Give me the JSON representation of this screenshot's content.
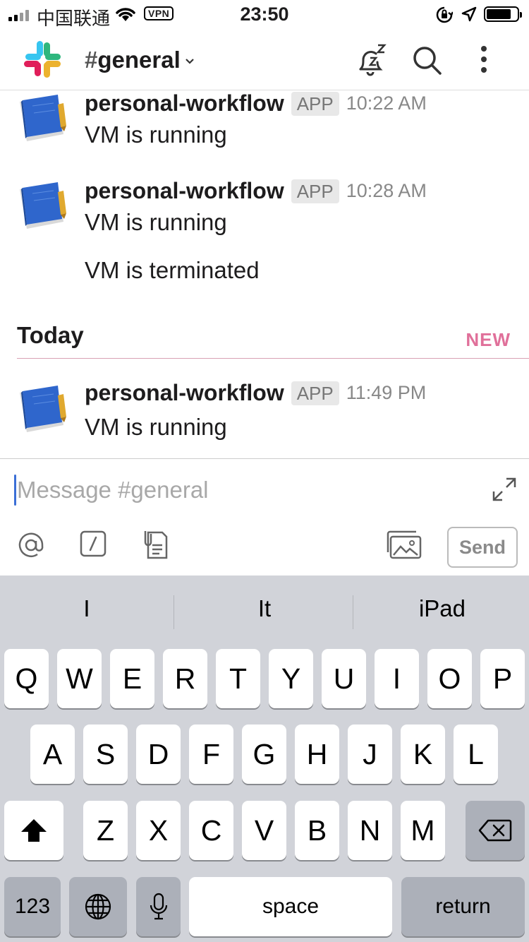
{
  "status_bar": {
    "carrier": "中国联通",
    "vpn": "VPN",
    "time": "23:50"
  },
  "header": {
    "hash": "#",
    "channel": "general",
    "icons": [
      "slack-logo-icon",
      "snooze-bell-icon",
      "search-icon",
      "more-vertical-icon"
    ]
  },
  "messages": [
    {
      "sender": "personal-workflow",
      "badge": "APP",
      "time": "10:22 AM",
      "lines": [
        "VM is running"
      ]
    },
    {
      "sender": "personal-workflow",
      "badge": "APP",
      "time": "10:28 AM",
      "lines": [
        "VM is running",
        "VM is terminated"
      ]
    },
    {
      "sender": "personal-workflow",
      "badge": "APP",
      "time": "11:49 PM",
      "lines": [
        "VM is running"
      ]
    }
  ],
  "divider": {
    "label": "Today",
    "new_label": "NEW"
  },
  "composer": {
    "placeholder": "Message #general",
    "send_label": "Send",
    "tools": [
      "at-icon",
      "slash-command-icon",
      "attach-file-icon",
      "photo-icon",
      "expand-icon"
    ]
  },
  "keyboard": {
    "suggestions": [
      "I",
      "It",
      "iPad"
    ],
    "row1": [
      "Q",
      "W",
      "E",
      "R",
      "T",
      "Y",
      "U",
      "I",
      "O",
      "P"
    ],
    "row2": [
      "A",
      "S",
      "D",
      "F",
      "G",
      "H",
      "J",
      "K",
      "L"
    ],
    "row3": [
      "Z",
      "X",
      "C",
      "V",
      "B",
      "N",
      "M"
    ],
    "numbers_label": "123",
    "space_label": "space",
    "return_label": "return"
  },
  "colors": {
    "new_divider": "#e0709a",
    "cursor": "#3b6fd6",
    "keyboard_bg": "#d1d3d9"
  }
}
